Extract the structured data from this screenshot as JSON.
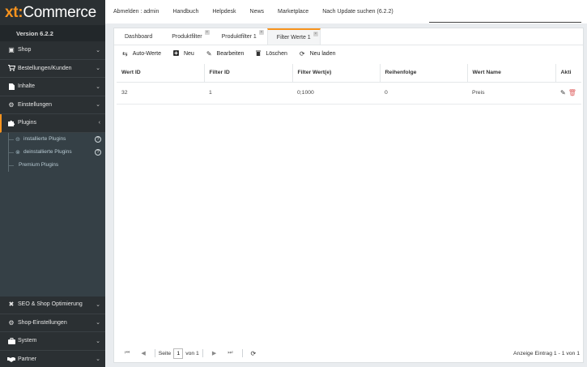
{
  "app": {
    "logo_xt": "xt:",
    "logo_commerce": "Commerce",
    "version": "Version 6.2.2"
  },
  "sidebar": {
    "items": [
      {
        "label": "Shop",
        "icon": "store-icon"
      },
      {
        "label": "Bestellungen/Kunden",
        "icon": "cart-icon"
      },
      {
        "label": "Inhalte",
        "icon": "document-icon"
      },
      {
        "label": "Einstellungen",
        "icon": "gear-icon"
      },
      {
        "label": "Plugins",
        "icon": "puzzle-icon"
      }
    ],
    "plugins_sub": [
      {
        "label": "installierte Plugins",
        "icon": "check-circle-icon"
      },
      {
        "label": "deinstallierte Plugins",
        "icon": "x-circle-icon"
      },
      {
        "label": "Premium Plugins"
      }
    ],
    "bottom_items": [
      {
        "label": "SEO & Shop Optimierung",
        "icon": "tools-icon"
      },
      {
        "label": "Shop-Einstellungen",
        "icon": "gears-icon"
      },
      {
        "label": "System",
        "icon": "briefcase-icon"
      },
      {
        "label": "Partner",
        "icon": "handshake-icon"
      }
    ]
  },
  "topbar": {
    "links": [
      "Abmelden : admin",
      "Handbuch",
      "Helpdesk",
      "News",
      "Marketplace",
      "Nach Update suchen (6.2.2)"
    ]
  },
  "tabs": [
    {
      "label": "Dashboard",
      "closable": false,
      "active": false
    },
    {
      "label": "Produktfilter",
      "closable": true,
      "active": false
    },
    {
      "label": "Produktfilter 1",
      "closable": true,
      "active": false
    },
    {
      "label": "Filter Werte 1",
      "closable": true,
      "active": true
    }
  ],
  "toolbar": {
    "auto_werte": "Auto-Werte",
    "neu": "Neu",
    "bearbeiten": "Bearbeiten",
    "loeschen": "Löschen",
    "neu_laden": "Neu laden"
  },
  "table": {
    "headers": [
      "Wert ID",
      "Filter ID",
      "Filter Wert(e)",
      "Reihenfolge",
      "Wert Name",
      "Akti"
    ],
    "rows": [
      [
        "32",
        "1",
        "0;1000",
        "0",
        "Preis"
      ]
    ]
  },
  "pager": {
    "page_label": "Seite",
    "page_value": "1",
    "of_label": "von 1",
    "info": "Anzeige Eintrag 1 - 1 von 1"
  },
  "colors": {
    "accent": "#f7931e",
    "sidebar_bg": "#2b3033",
    "plugin_sub_bg": "#354046"
  }
}
